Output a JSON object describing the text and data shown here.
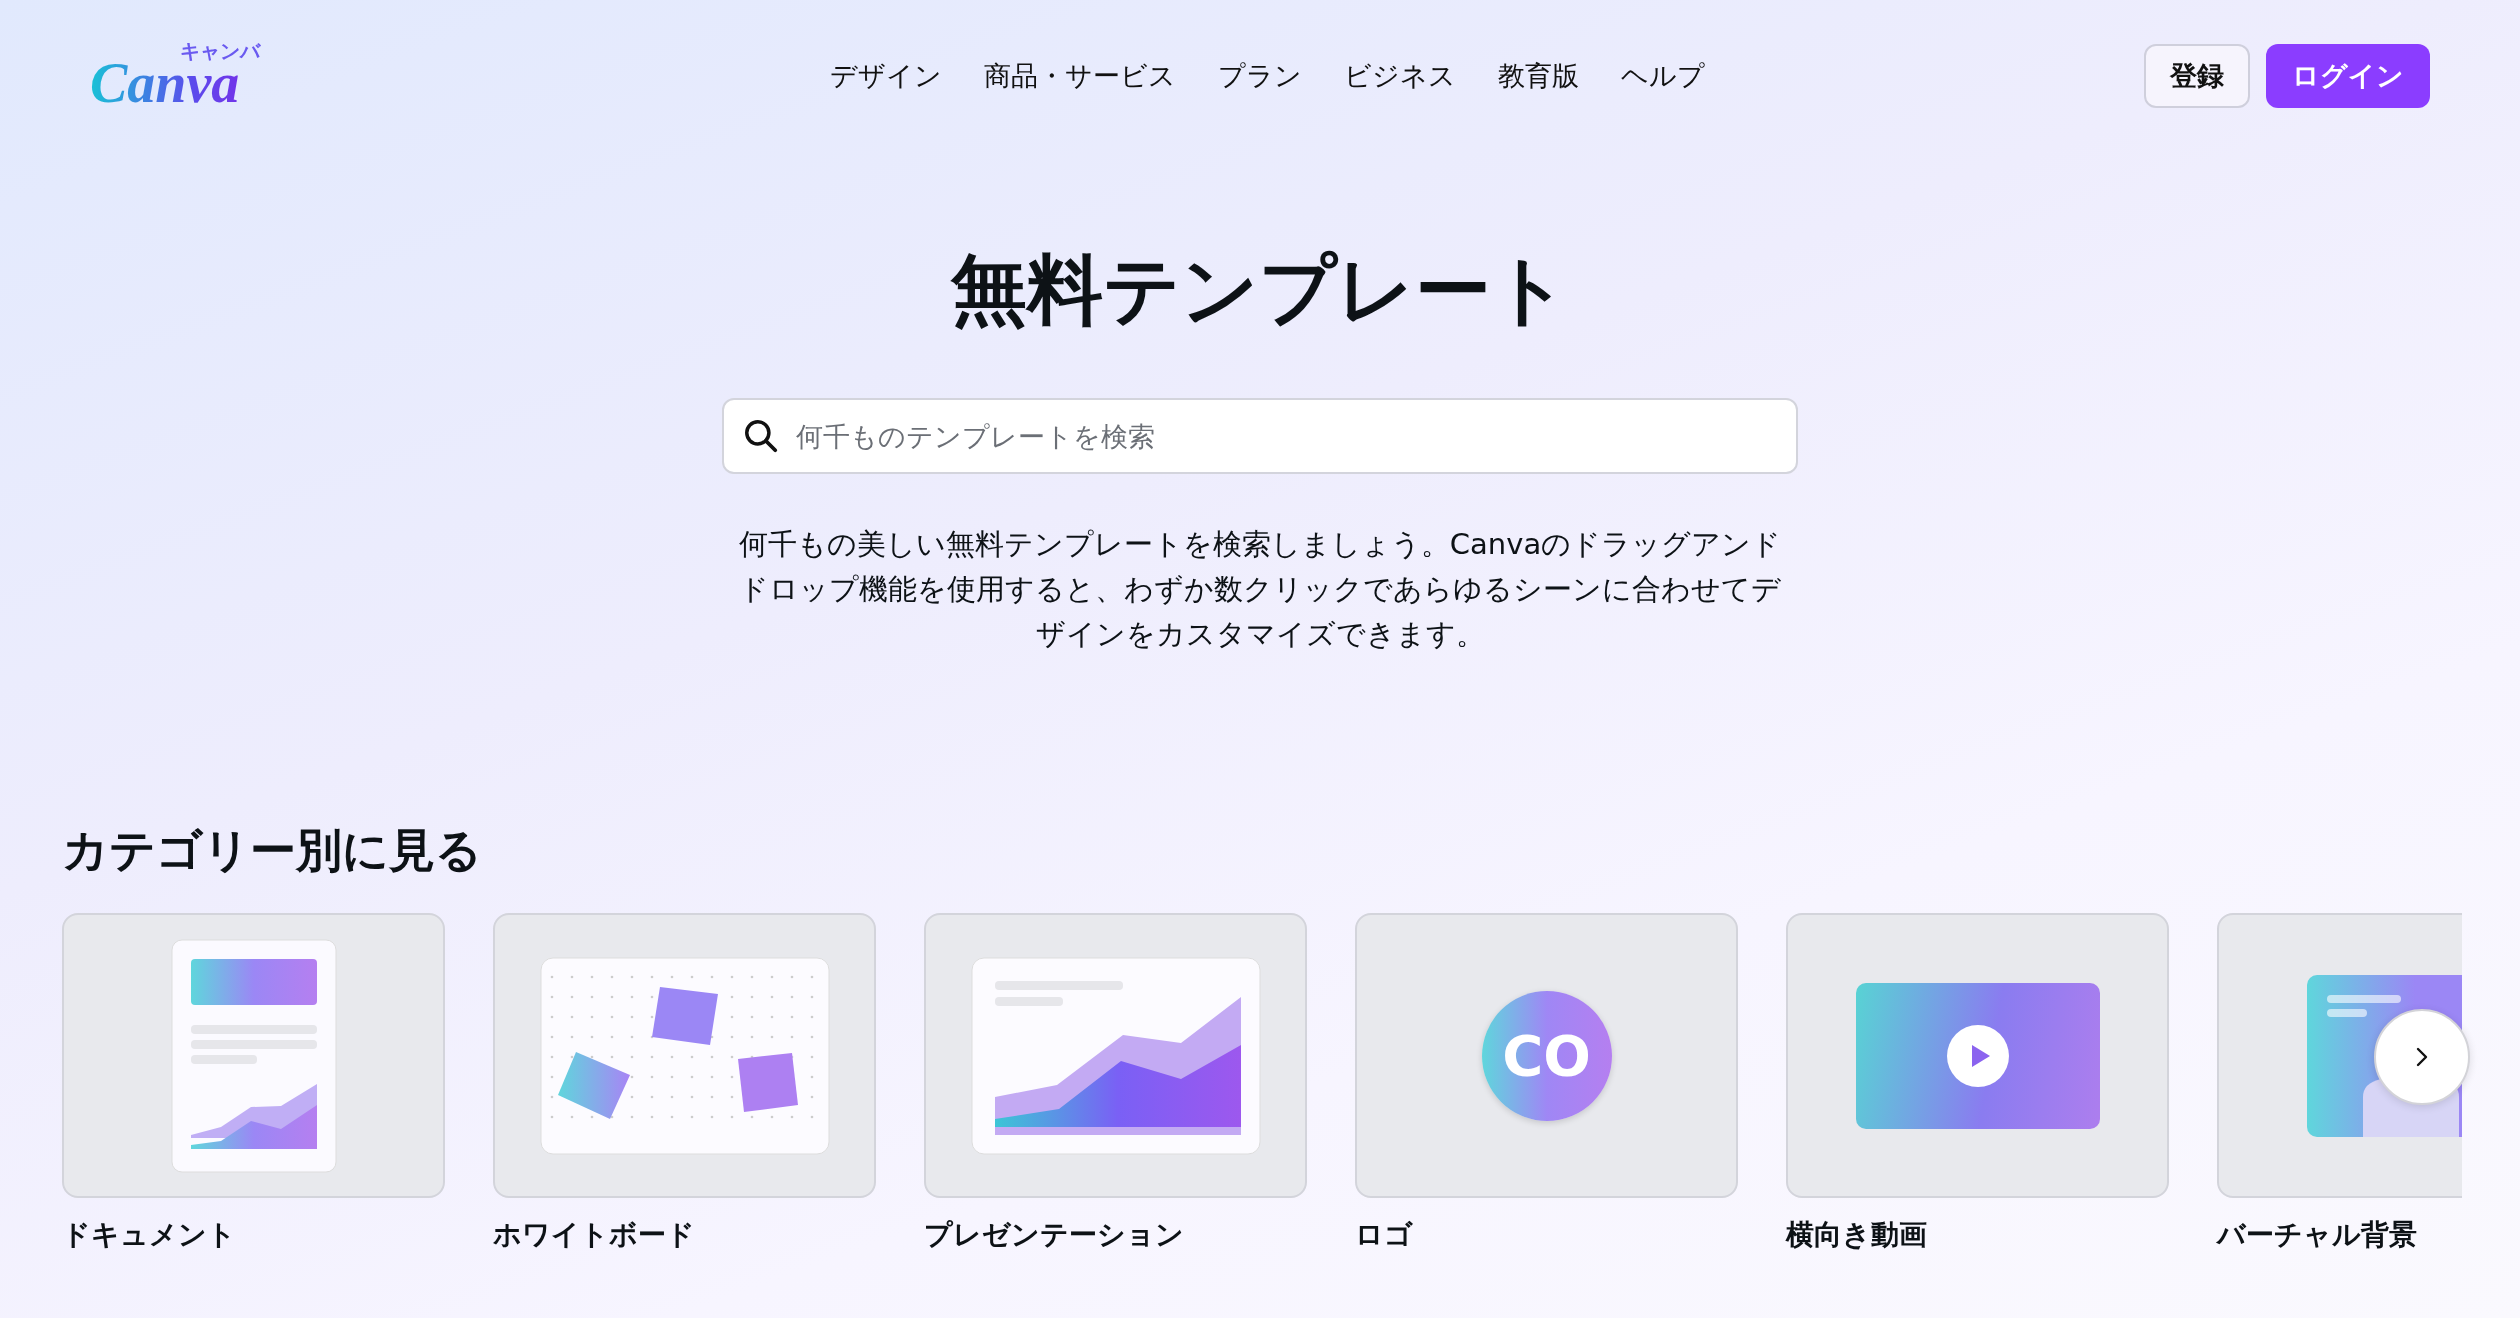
{
  "header": {
    "logo": {
      "wordmark": "Canva",
      "subtitle": "キャンバ"
    },
    "nav": [
      "デザイン",
      "商品・サービス",
      "プラン",
      "ビジネス",
      "教育版",
      "ヘルプ"
    ],
    "buttons": [
      {
        "label": "登録",
        "kind": "outline"
      },
      {
        "label": "ログイン",
        "kind": "primary"
      }
    ]
  },
  "hero": {
    "title": "無料テンプレート",
    "search": {
      "placeholder": "何千ものテンプレートを検索"
    },
    "description": "何千もの美しい無料テンプレートを検索しましょう。Canvaのドラッグアンドドロップ機能を使用すると、わずか数クリックであらゆるシーンに合わせてデザインをカスタマイズできます。"
  },
  "categories": {
    "heading": "カテゴリー別に見る",
    "items": [
      {
        "label": "ドキュメント",
        "kind": "document"
      },
      {
        "label": "ホワイトボード",
        "kind": "whiteboard"
      },
      {
        "label": "プレゼンテーション",
        "kind": "presentation"
      },
      {
        "label": "ロゴ",
        "kind": "logo",
        "art_text": "CO"
      },
      {
        "label": "横向き動画",
        "kind": "video"
      },
      {
        "label": "バーチャル背景",
        "kind": "virtual-background"
      }
    ]
  }
}
